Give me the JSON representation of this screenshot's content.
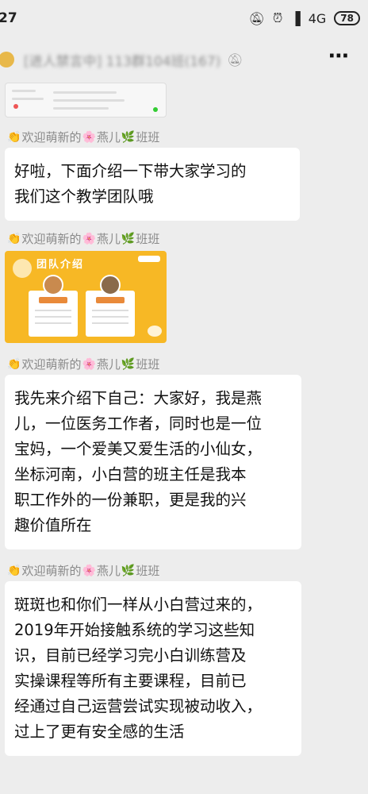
{
  "status_bar": {
    "time": "27",
    "network": "4G",
    "battery": "78"
  },
  "header": {
    "title": "[进人禁言中] 113群104班(167)"
  },
  "sender": {
    "prefix": "欢迎萌新的",
    "name1": "燕儿",
    "name2": "班班"
  },
  "messages": [
    {
      "text": "好啦，下面介绍一下带大家学习的\n我们这个教学团队哦"
    },
    {
      "text": "我先来介绍下自己：大家好，我是燕\n儿，一位医务工作者，同时也是一位\n宝妈，一个爱美又爱生活的小仙女，\n坐标河南，小白营的班主任是我本\n职工作外的一份兼职，更是我的兴\n趣价值所在"
    },
    {
      "text": "斑斑也和你们一样从小白营过来的，\n2019年开始接触系统的学习这些知\n识，目前已经学习完小白训练营及\n实操课程等所有主要课程，目前已\n经通过自己运营尝试实现被动收入，\n过上了更有安全感的生活"
    }
  ],
  "team_image": {
    "title": "团队介绍"
  },
  "colors": {
    "background": "#ededed",
    "bubble": "#ffffff",
    "team_image_bg": "#f7b825"
  }
}
